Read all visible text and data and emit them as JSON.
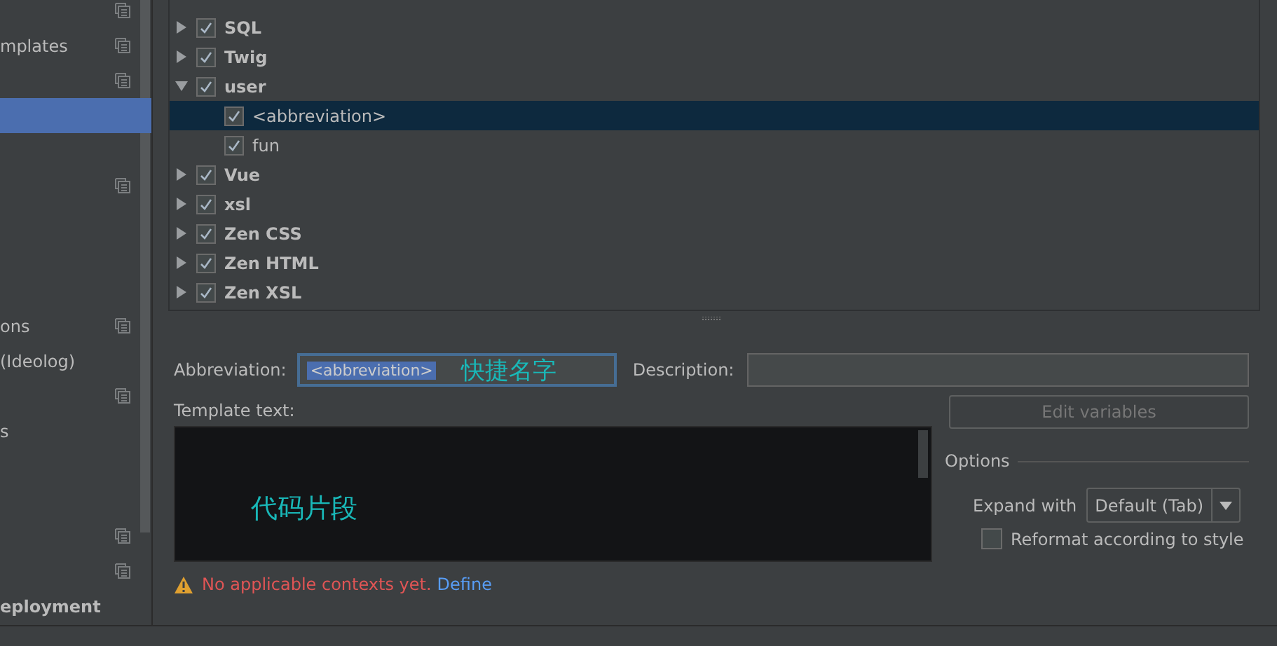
{
  "sidebar": {
    "items": [
      {
        "copy": true,
        "selected": false
      },
      {
        "label": "mplates",
        "copy": true,
        "selected": false
      },
      {
        "copy": true,
        "selected": false
      },
      {
        "copy": false,
        "selected": true
      },
      {
        "copy": false,
        "selected": false
      },
      {
        "copy": true,
        "selected": false
      },
      {
        "copy": false,
        "selected": false
      },
      {
        "copy": false,
        "selected": false
      },
      {
        "copy": false,
        "selected": false
      },
      {
        "label": "ons",
        "copy": true,
        "selected": false
      },
      {
        "label": "(Ideolog)",
        "copy": false,
        "selected": false
      },
      {
        "copy": true,
        "selected": false
      },
      {
        "label": "s",
        "copy": false,
        "selected": false
      },
      {
        "copy": false,
        "selected": false
      },
      {
        "copy": false,
        "selected": false
      },
      {
        "copy": true,
        "selected": false
      },
      {
        "copy": true,
        "selected": false
      },
      {
        "label": "eployment",
        "bold": true,
        "copy": false,
        "selected": false
      }
    ]
  },
  "tree": [
    {
      "label": "SQL",
      "checked": true,
      "expanded": false,
      "selected": false
    },
    {
      "label": "Twig",
      "checked": true,
      "expanded": false,
      "selected": false
    },
    {
      "label": "user",
      "checked": true,
      "expanded": true,
      "selected": false,
      "children": [
        {
          "label": "<abbreviation>",
          "checked": true,
          "selected": true
        },
        {
          "label": "fun",
          "checked": true,
          "selected": false
        }
      ]
    },
    {
      "label": "Vue",
      "checked": true,
      "expanded": false,
      "selected": false
    },
    {
      "label": "xsl",
      "checked": true,
      "expanded": false,
      "selected": false
    },
    {
      "label": "Zen CSS",
      "checked": true,
      "expanded": false,
      "selected": false
    },
    {
      "label": "Zen HTML",
      "checked": true,
      "expanded": false,
      "selected": false
    },
    {
      "label": "Zen XSL",
      "checked": true,
      "expanded": false,
      "selected": false
    }
  ],
  "abbreviation": {
    "label": "Abbreviation:",
    "value": "<abbreviation>",
    "note": "快捷名字"
  },
  "description": {
    "label": "Description:"
  },
  "template": {
    "label": "Template text:",
    "note": "代码片段"
  },
  "edit_variables": {
    "label": "Edit variables",
    "disabled": true
  },
  "options": {
    "title": "Options",
    "expand_label": "Expand with",
    "expand_value": "Default (Tab)",
    "reformat": {
      "label": "Reformat according to style",
      "checked": false
    }
  },
  "warning": {
    "text": "No applicable contexts yet.",
    "link": "Define"
  }
}
